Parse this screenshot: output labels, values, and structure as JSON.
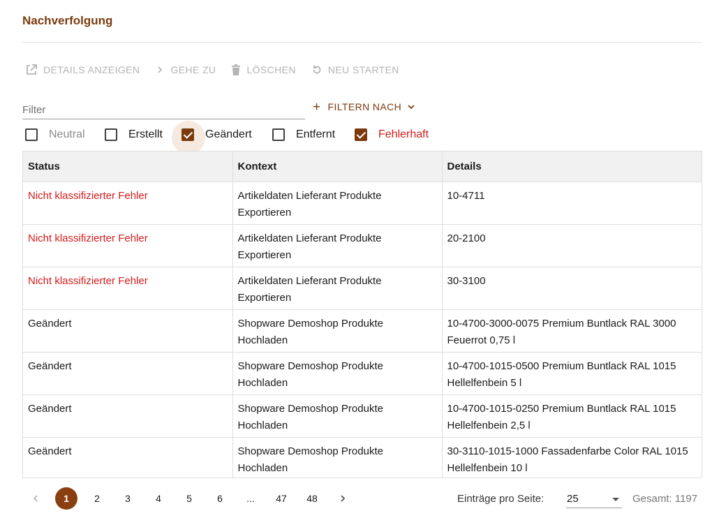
{
  "page": {
    "title": "Nachverfolgung"
  },
  "toolbar": {
    "details_label": "DETAILS ANZEIGEN",
    "goto_label": "GEHE ZU",
    "delete_label": "LÖSCHEN",
    "restart_label": "NEU STARTEN"
  },
  "filter": {
    "placeholder": "Filter",
    "filter_by_label": "FILTERN NACH"
  },
  "checkboxes": [
    {
      "label": "Neutral",
      "checked": false
    },
    {
      "label": "Erstellt",
      "checked": false
    },
    {
      "label": "Geändert",
      "checked": true
    },
    {
      "label": "Entfernt",
      "checked": false
    },
    {
      "label": "Fehlerhaft",
      "checked": true
    }
  ],
  "table": {
    "headers": [
      "Status",
      "Kontext",
      "Details"
    ],
    "rows": [
      {
        "status": "Nicht klassifizierter Fehler",
        "context": "Artikeldaten Lieferant Produkte Exportieren",
        "details1": "10-4711",
        "details2": "",
        "error": true
      },
      {
        "status": "Nicht klassifizierter Fehler",
        "context": "Artikeldaten Lieferant Produkte Exportieren",
        "details1": "20-2100",
        "details2": "",
        "error": true
      },
      {
        "status": "Nicht klassifizierter Fehler",
        "context": "Artikeldaten Lieferant Produkte Exportieren",
        "details1": "30-3100",
        "details2": "",
        "error": true
      },
      {
        "status": "Geändert",
        "context": "Shopware Demoshop Produkte Hochladen",
        "details1": "10-4700-3000-0075 Premium Buntlack RAL 3000",
        "details2": "Feuerrot 0,75 l",
        "error": false
      },
      {
        "status": "Geändert",
        "context": "Shopware Demoshop Produkte Hochladen",
        "details1": "10-4700-1015-0500 Premium Buntlack RAL 1015",
        "details2": "Hellelfenbein 5 l",
        "error": false
      },
      {
        "status": "Geändert",
        "context": "Shopware Demoshop Produkte Hochladen",
        "details1": "10-4700-1015-0250 Premium Buntlack RAL 1015",
        "details2": "Hellelfenbein 2,5 l",
        "error": false
      },
      {
        "status": "Geändert",
        "context": "Shopware Demoshop Produkte Hochladen",
        "details1": "30-3110-1015-1000 Fassadenfarbe Color RAL 1015",
        "details2": "Hellelfenbein 10 l",
        "error": false
      }
    ]
  },
  "pagination": {
    "pages": [
      "1",
      "2",
      "3",
      "4",
      "5",
      "6",
      "...",
      "47",
      "48"
    ],
    "active": "1",
    "per_page_label": "Einträge pro Seite:",
    "per_page_value": "25",
    "total": "Gesamt: 1197"
  },
  "colors": {
    "accent": "#7a3a0e",
    "error": "#d31c1c",
    "disabled": "#b4b4b4"
  }
}
